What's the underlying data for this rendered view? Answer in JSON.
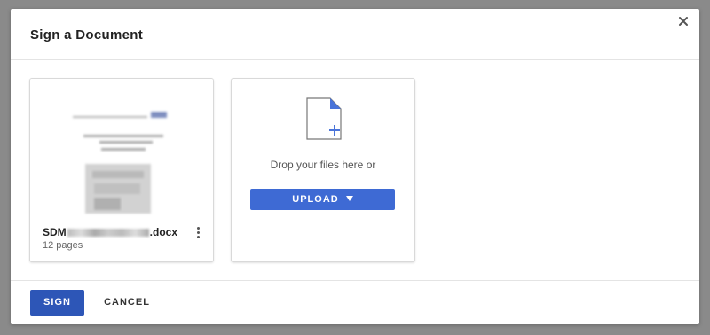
{
  "dialog": {
    "title": "Sign a Document",
    "close_icon": "close-icon"
  },
  "file_card": {
    "name_prefix": "SDM",
    "name_suffix": ".docx",
    "pages": "12 pages",
    "menu_icon": "more-vertical-icon"
  },
  "drop_zone": {
    "icon": "document-add-icon",
    "text": "Drop your files here or",
    "upload_label": "UPLOAD",
    "upload_caret_icon": "caret-down-icon"
  },
  "footer": {
    "sign_label": "SIGN",
    "cancel_label": "CANCEL"
  },
  "colors": {
    "primary": "#3e6ad4",
    "sign_button": "#2d56b7",
    "overlay": "#8a8a8a"
  }
}
